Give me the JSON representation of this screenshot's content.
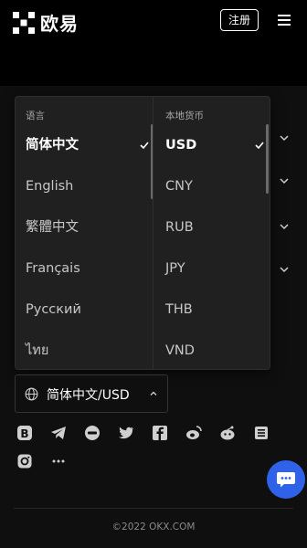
{
  "header": {
    "brand": "欧易",
    "register_label": "注册",
    "logo_icon": "okx-logo-icon",
    "menu_icon": "hamburger-menu-icon"
  },
  "dropdown": {
    "language_header": "语言",
    "currency_header": "本地货币",
    "languages": [
      "简体中文",
      "English",
      "繁體中文",
      "Français",
      "Русский",
      "ไทย"
    ],
    "selected_language": "简体中文",
    "currencies": [
      "USD",
      "CNY",
      "RUB",
      "JPY",
      "THB",
      "VND"
    ],
    "selected_currency": "USD"
  },
  "selector": {
    "value": "简体中文/USD",
    "icon": "globe-icon"
  },
  "social_icons": [
    "bitcoin-icon",
    "telegram-icon",
    "line-icon",
    "twitter-icon",
    "facebook-icon",
    "weibo-icon",
    "reddit-icon",
    "news-icon",
    "instagram-icon",
    "more-icon"
  ],
  "chat": {
    "icon": "chat-support-icon",
    "color": "#2f62e8"
  },
  "footer": {
    "copyright": "©2022 OKX.COM"
  }
}
